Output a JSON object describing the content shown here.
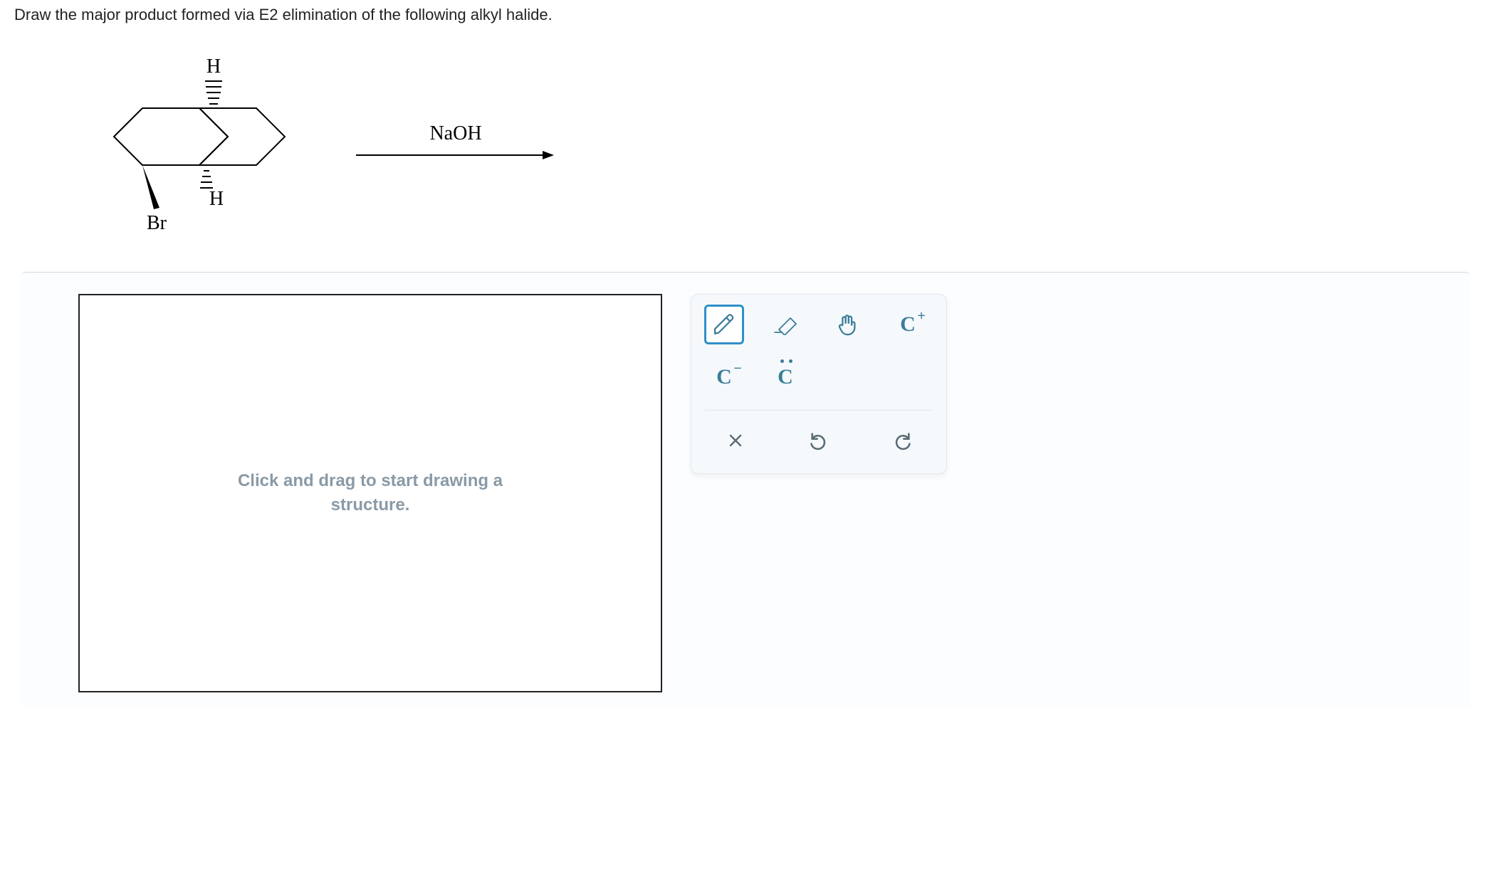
{
  "question": "Draw the major product formed via E2 elimination of the following alkyl halide.",
  "structure": {
    "labels": {
      "H_top": "H",
      "H_bottom": "H",
      "Br": "Br"
    }
  },
  "reaction": {
    "reagent": "NaOH"
  },
  "canvas": {
    "placeholder": "Click and drag to start drawing a structure."
  },
  "tools": {
    "pencil": "pencil-icon",
    "eraser": "eraser-icon",
    "move": "hand-icon",
    "cation": "C",
    "cation_sup": "+",
    "anion": "C",
    "anion_sup": "−",
    "radical": "C"
  },
  "actions": {
    "clear": "clear-icon",
    "undo": "undo-icon",
    "redo": "redo-icon"
  }
}
